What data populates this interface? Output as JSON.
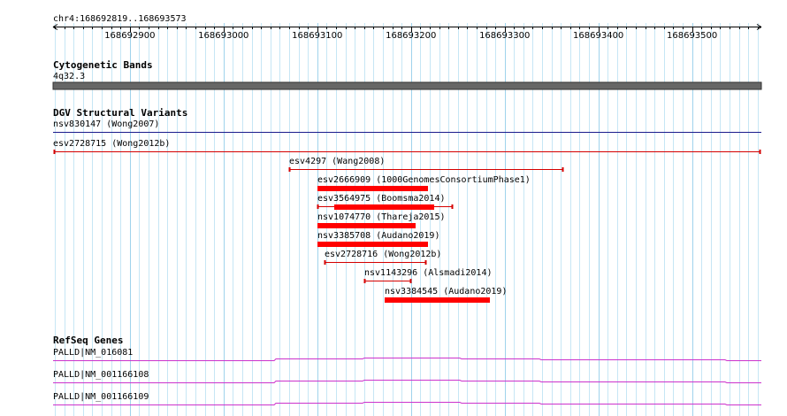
{
  "locus": "chr4:168692819..168693573",
  "colors": {
    "grid_minor": "#c6e6f5",
    "grid_major": "#9fd3ec",
    "variant": "#ff0000",
    "variant_line": "#d40000",
    "nsv_line": "#1a1a8c",
    "gene": "#cc33cc",
    "band": "#666666"
  },
  "ruler": {
    "start": 168692819,
    "end": 168693573,
    "ticks": [
      "168692900",
      "168693000",
      "168693100",
      "168693200",
      "168693300",
      "168693400",
      "168693500"
    ]
  },
  "tracks": {
    "cytoband": {
      "title": "Cytogenetic Bands",
      "band_label": "4q32.3"
    },
    "dgv": {
      "title": "DGV Structural Variants",
      "features": [
        {
          "label": "nsv830147 (Wong2007)",
          "style": "nsv_line",
          "start": 168692819,
          "end": 168693573,
          "label_above": true,
          "row": 0
        },
        {
          "label": "esv2728715 (Wong2012b)",
          "style": "thin",
          "start": 168692819,
          "end": 168693573,
          "row": 1
        },
        {
          "label": "esv4297 (Wang2008)",
          "style": "thin",
          "start": 168693070,
          "end": 168693363,
          "row": 2
        },
        {
          "label": "esv2666909 (1000GenomesConsortiumPhase1)",
          "style": "thick",
          "start": 168693100,
          "end": 168693218,
          "row": 3
        },
        {
          "label": "esv3564975 (Boomsma2014)",
          "style": "mixed",
          "start": 168693100,
          "end": 168693245,
          "thick_start": 168693118,
          "thick_end": 168693225,
          "row": 4
        },
        {
          "label": "nsv1074770 (Thareja2015)",
          "style": "thick",
          "start": 168693100,
          "end": 168693205,
          "row": 5
        },
        {
          "label": "nsv3385708 (Audano2019)",
          "style": "thick",
          "start": 168693100,
          "end": 168693218,
          "row": 6
        },
        {
          "label": "esv2728716 (Wong2012b)",
          "style": "thin",
          "start": 168693108,
          "end": 168693216,
          "row": 7
        },
        {
          "label": "nsv1143296 (Alsmadi2014)",
          "style": "thin",
          "start": 168693150,
          "end": 168693200,
          "row": 8
        },
        {
          "label": "nsv3384545 (Audano2019)",
          "style": "thick",
          "start": 168693172,
          "end": 168693284,
          "row": 9
        }
      ]
    },
    "refseq": {
      "title": "RefSeq Genes",
      "genes": [
        {
          "label": "PALLD|NM_016081"
        },
        {
          "label": "PALLD|NM_001166108"
        },
        {
          "label": "PALLD|NM_001166109"
        }
      ]
    }
  }
}
